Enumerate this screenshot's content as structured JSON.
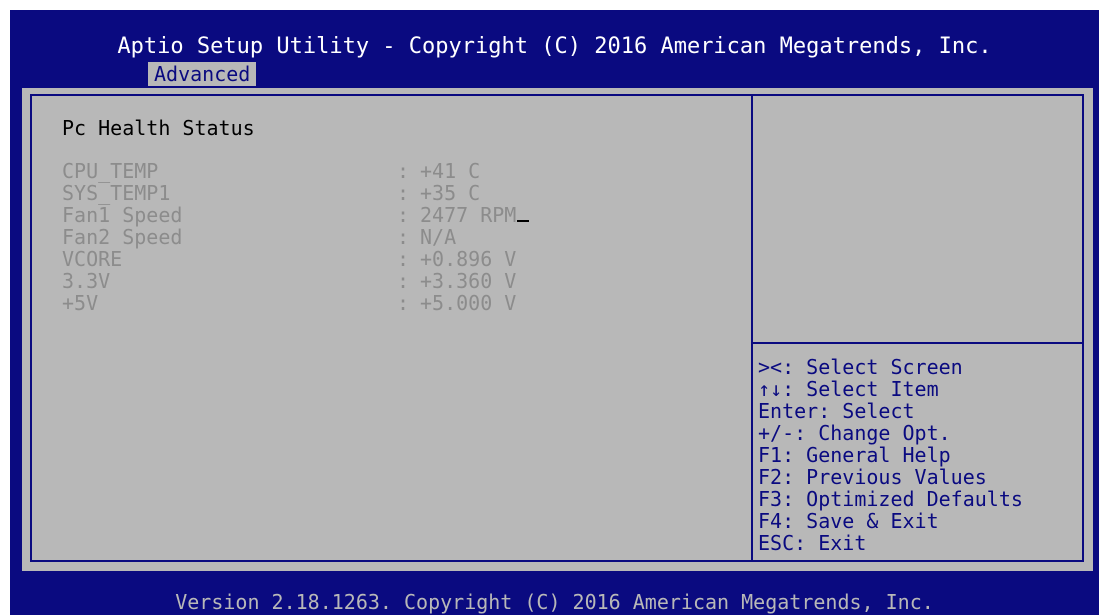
{
  "header": {
    "title": "Aptio Setup Utility - Copyright (C) 2016 American Megatrends, Inc.",
    "tabs": [
      {
        "label": "Advanced",
        "active": true
      }
    ]
  },
  "main": {
    "section_title": "Pc Health Status",
    "rows": [
      {
        "label": "CPU_TEMP",
        "separator": ":",
        "value": "+41 C"
      },
      {
        "label": "SYS_TEMP1",
        "separator": ":",
        "value": "+35 C"
      },
      {
        "label": "Fan1 Speed",
        "separator": ":",
        "value": "2477 RPM"
      },
      {
        "label": "Fan2 Speed",
        "separator": ":",
        "value": "N/A"
      },
      {
        "label": "VCORE",
        "separator": ":",
        "value": "+0.896 V"
      },
      {
        "label": "3.3V",
        "separator": ":",
        "value": "+3.360 V"
      },
      {
        "label": "+5V",
        "separator": ":",
        "value": "+5.000 V"
      }
    ]
  },
  "help": {
    "items": [
      "><: Select Screen",
      "↑↓: Select Item",
      "Enter: Select",
      "+/-: Change Opt.",
      "F1: General Help",
      "F2: Previous Values",
      "F3: Optimized Defaults",
      "F4: Save & Exit",
      "ESC: Exit"
    ]
  },
  "footer": {
    "text": "Version 2.18.1263. Copyright (C) 2016 American Megatrends, Inc."
  },
  "colors": {
    "background_blue": "#0a0a80",
    "panel_gray": "#b8b8b8",
    "disabled_text": "#8c8c8c"
  }
}
